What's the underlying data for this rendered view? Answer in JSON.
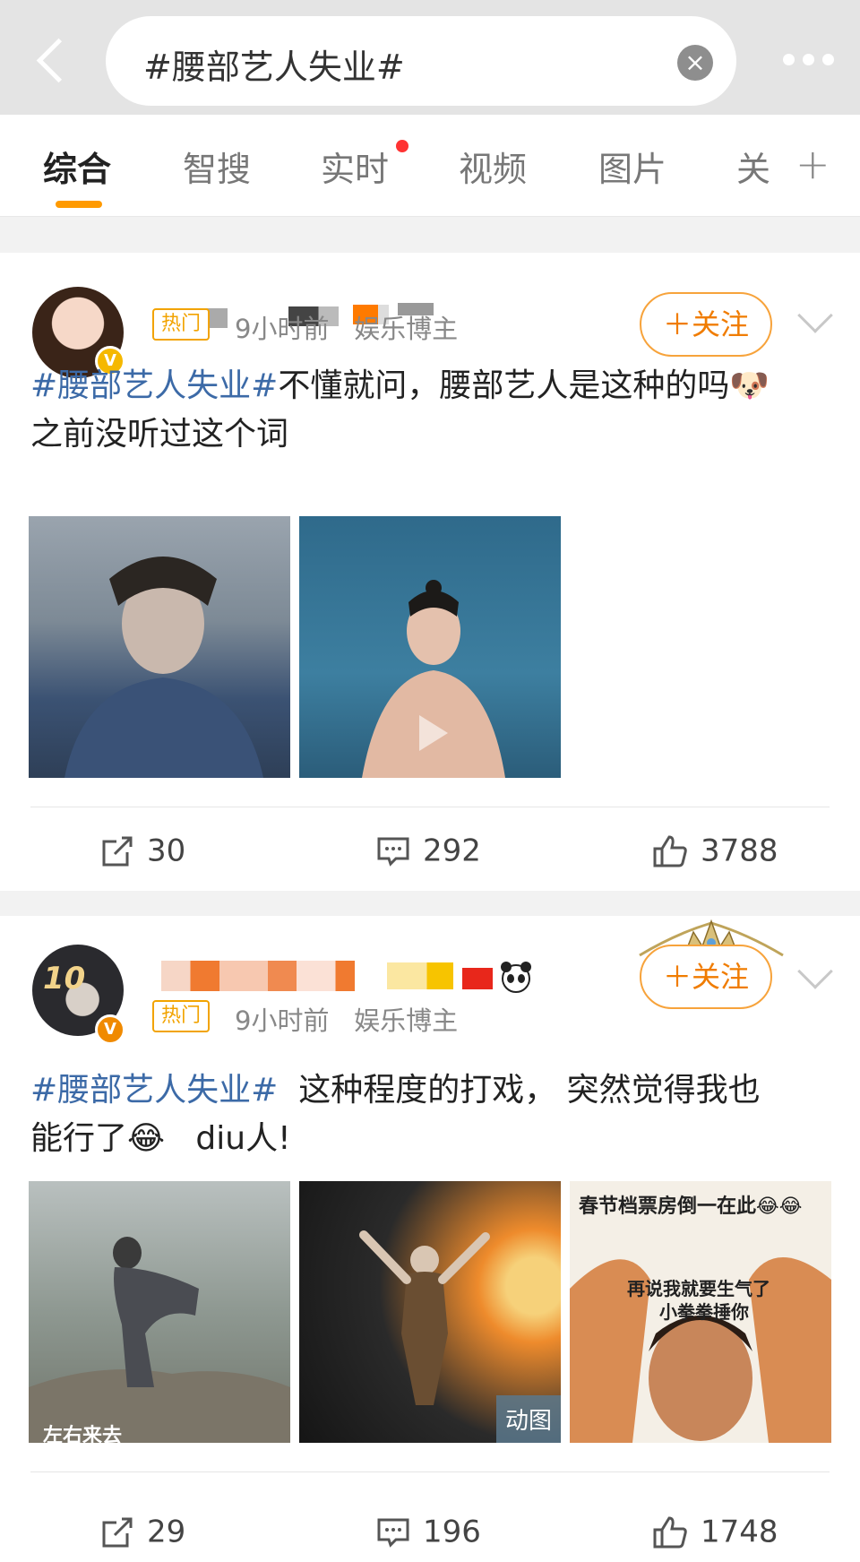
{
  "search": {
    "query": "#腰部艺人失业#",
    "clear": "×"
  },
  "tabs": [
    {
      "label": "综合",
      "active": true
    },
    {
      "label": "智搜"
    },
    {
      "label": "实时",
      "dot": true
    },
    {
      "label": "视频"
    },
    {
      "label": "图片"
    },
    {
      "label": "关"
    }
  ],
  "tabs_plus": "+",
  "posts": [
    {
      "badge": "热门",
      "time": "9小时前",
      "role": "娱乐博主",
      "follow": "＋关注",
      "verified": "V",
      "text_tag": "#腰部艺人失业#",
      "text_body": "不懂就问，腰部艺人是这种的吗🐶",
      "text_line2": "之前没听过这个词",
      "reposts": "30",
      "comments": "292",
      "likes": "3788"
    },
    {
      "badge": "热门",
      "time": "9小时前",
      "role": "娱乐博主",
      "follow": "＋关注",
      "verified": "V",
      "avatar_text": "10",
      "text_tag": "#腰部艺人失业#",
      "text_body": "  这种程度的打戏， 突然觉得我也",
      "text_line2": "能行了😂   diu人!",
      "image_badge": "动图",
      "image3_caption": "春节档票房倒一在此😂😂",
      "image3_text1": "再说我就要生气了",
      "image3_text2": "小拳拳捶你",
      "image1_caption": "左右来去",
      "reposts": "29",
      "comments": "196",
      "likes": "1748"
    }
  ],
  "colors": {
    "accent": "#ff9a00",
    "link": "#3c6aa7",
    "follow": "#f07c00"
  }
}
